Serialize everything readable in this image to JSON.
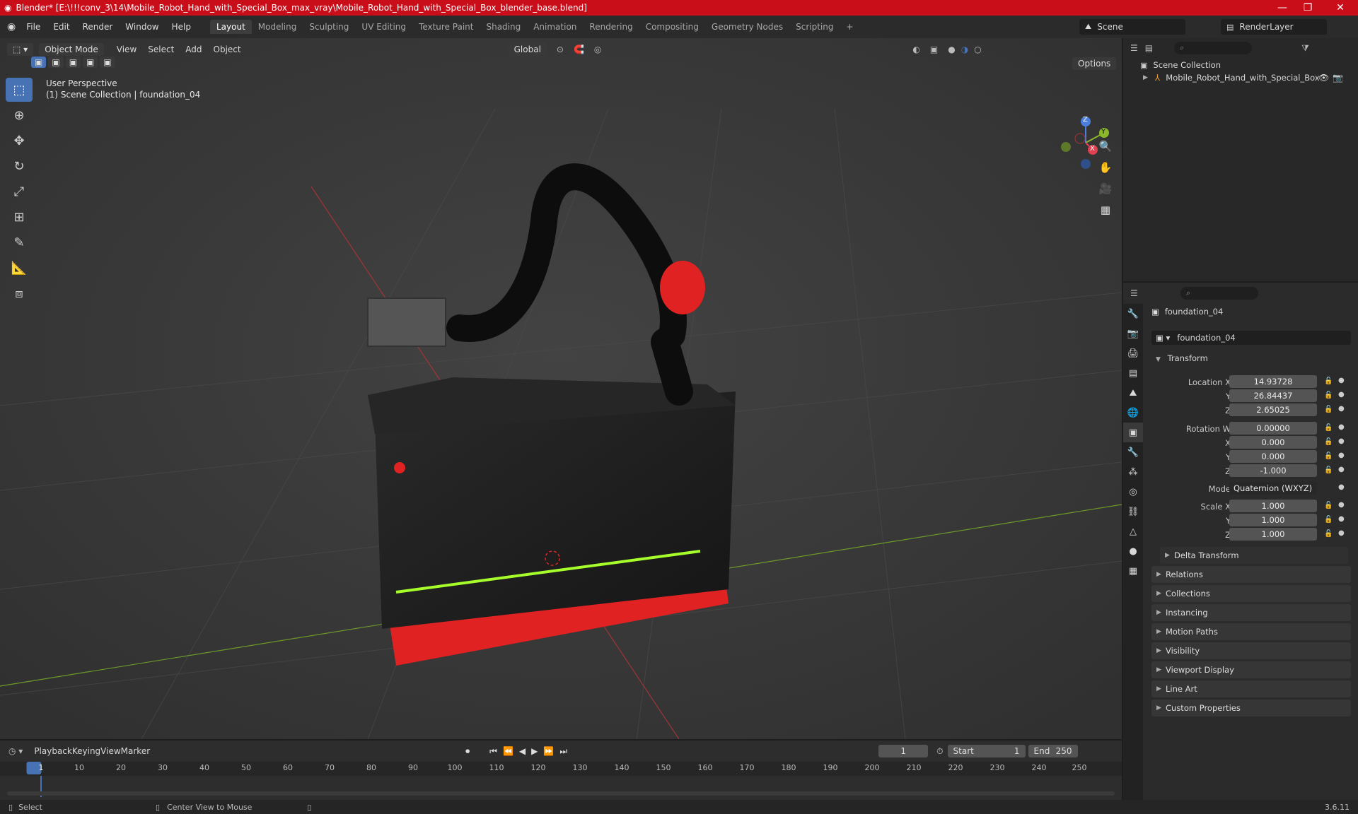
{
  "title_bar": {
    "title": "Blender* [E:\\!!!conv_3\\14\\Mobile_Robot_Hand_with_Special_Box_max_vray\\Mobile_Robot_Hand_with_Special_Box_blender_base.blend]",
    "minimize": "—",
    "maximize": "❐",
    "close": "✕"
  },
  "menu": {
    "file": "File",
    "edit": "Edit",
    "render": "Render",
    "window": "Window",
    "help": "Help"
  },
  "workspaces": [
    "Layout",
    "Modeling",
    "Sculpting",
    "UV Editing",
    "Texture Paint",
    "Shading",
    "Animation",
    "Rendering",
    "Compositing",
    "Geometry Nodes",
    "Scripting"
  ],
  "add_workspace": "+",
  "scene": {
    "name": "Scene",
    "view_layer": "RenderLayer"
  },
  "viewport_header": {
    "mode": "Object Mode",
    "view": "View",
    "select": "Select",
    "add": "Add",
    "object": "Object",
    "transform_orientation": "Global",
    "options": "Options"
  },
  "viewport_overlay": {
    "line1": "User Perspective",
    "line2": "(1) Scene Collection | foundation_04"
  },
  "gizmo": {
    "z": "Z",
    "y": "Y",
    "x": "X"
  },
  "outliner": {
    "root": "Scene Collection",
    "items": [
      {
        "name": "Mobile_Robot_Hand_with_Special_Box"
      }
    ]
  },
  "properties": {
    "object_name": "foundation_04",
    "data_name": "foundation_04",
    "transform_label": "Transform",
    "location": {
      "label": "Location X",
      "x": "14.93728",
      "y_label": "Y",
      "y": "26.84437",
      "z_label": "Z",
      "z": "2.65025"
    },
    "rotation": {
      "label": "Rotation W",
      "w": "0.00000",
      "x_label": "X",
      "x": "0.000",
      "y_label": "Y",
      "y": "0.000",
      "z_label": "Z",
      "z": "-1.000"
    },
    "mode_label": "Mode",
    "mode": "Quaternion (WXYZ)",
    "scale": {
      "label": "Scale X",
      "x": "1.000",
      "y_label": "Y",
      "y": "1.000",
      "z_label": "Z",
      "z": "1.000"
    },
    "delta_transform": "Delta Transform",
    "panels": [
      "Relations",
      "Collections",
      "Instancing",
      "Motion Paths",
      "Visibility",
      "Viewport Display",
      "Line Art",
      "Custom Properties"
    ]
  },
  "timeline": {
    "playback": "Playback",
    "keying": "Keying",
    "view": "View",
    "marker": "Marker",
    "current_frame": "1",
    "start_label": "Start",
    "start": "1",
    "end_label": "End",
    "end": "250",
    "ticks": [
      "1",
      "10",
      "20",
      "30",
      "40",
      "50",
      "60",
      "70",
      "80",
      "90",
      "100",
      "110",
      "120",
      "130",
      "140",
      "150",
      "160",
      "170",
      "180",
      "190",
      "200",
      "210",
      "220",
      "230",
      "240",
      "250"
    ]
  },
  "status": {
    "select": "Select",
    "center_view": "Center View to Mouse",
    "version": "3.6.11"
  },
  "colors": {
    "accent": "#4772b3",
    "title_bar": "#c90e1a",
    "robot_red": "#e02222",
    "led_green": "#a6ff2a"
  }
}
